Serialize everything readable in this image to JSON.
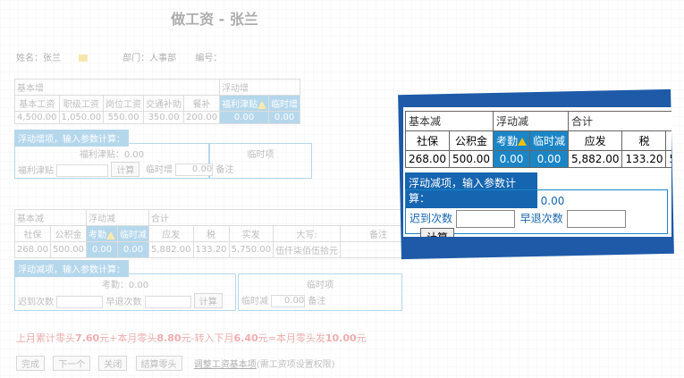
{
  "page_title": "做工资 - 张兰",
  "info": {
    "name": "姓名：张兰",
    "dept": "部门：人事部",
    "id": "编号："
  },
  "table1": {
    "group_basic": "基本增",
    "group_float": "浮动增",
    "headers": [
      "基本工资",
      "职级工资",
      "岗位工资",
      "交通补助",
      "餐补",
      "福利津贴",
      "临时增"
    ],
    "values": [
      "4,500.00",
      "1,050.00",
      "550.00",
      "350.00",
      "200.00",
      "0.00",
      "0.00"
    ]
  },
  "float_add": {
    "title": "浮动增项，输入参数计算：",
    "welfare": "福利津贴：0.00",
    "welfare_label": "福利津贴",
    "temp_title": "临时项",
    "temp_label": "临时增",
    "temp_value": "0.00",
    "remark": "备注",
    "calc": "计算"
  },
  "table2": {
    "group_basic": "基本减",
    "group_float": "浮动减",
    "group_total": "合计",
    "headers": [
      "社保",
      "公积金",
      "考勤",
      "临时减",
      "应发",
      "税",
      "实发",
      "大写:",
      "备注"
    ],
    "values": [
      "268.00",
      "500.00",
      "0.00",
      "0.00",
      "5,882.00",
      "133.20",
      "5,750.00",
      "伍仟柒佰伍拾元",
      ""
    ]
  },
  "float_sub": {
    "title": "浮动减项，输入参数计算：",
    "attendance": "考勤：0.00",
    "late_label": "迟到次数",
    "early_label": "早退次数",
    "calc": "计算",
    "temp_title": "临时项",
    "temp_label": "临时减",
    "temp_value": "0.00",
    "remark": "备注"
  },
  "summary": {
    "p1": "上月累计零头",
    "v1": "7.60",
    "p2": "元+本月零头",
    "v2": "8.80",
    "p3": "元-转入下月",
    "v3": "6.40",
    "p4": "元=本月零头发",
    "v4": "10.00",
    "p5": "元"
  },
  "buttons": {
    "finish": "完成",
    "next": "下一个",
    "close": "关闭",
    "settle": "结算零头",
    "adjust": "调整工资基本项",
    "adjust_note": "(需工资项设置权限)"
  },
  "colors": {
    "accent": "#1b85c6",
    "callout_border": "#1e5aa8",
    "warn": "#f0c000"
  }
}
